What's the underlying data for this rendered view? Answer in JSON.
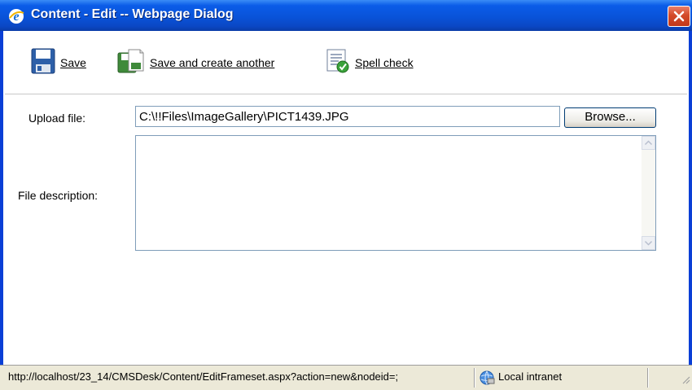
{
  "window": {
    "title": "Content - Edit -- Webpage Dialog"
  },
  "toolbar": {
    "save_label": "Save",
    "save_another_label": "Save and create another",
    "spell_check_label": "Spell check"
  },
  "form": {
    "upload_label": "Upload file:",
    "upload_value": "C:\\!!Files\\ImageGallery\\PICT1439.JPG",
    "browse_label": "Browse...",
    "description_label": "File description:",
    "description_value": ""
  },
  "statusbar": {
    "url": "http://localhost/23_14/CMSDesk/Content/EditFrameset.aspx?action=new&nodeid=;",
    "zone": "Local intranet"
  },
  "colors": {
    "titlebar": "#0953d9",
    "frame_border": "#0a3fd6",
    "close_button": "#d44a28",
    "statusbar": "#ece9d8"
  },
  "icons": {
    "title": "ie-icon",
    "close": "close-icon",
    "save": "floppy-disk-icon",
    "save_another": "save-new-document-icon",
    "spell": "spell-check-icon",
    "zone": "local-intranet-icon"
  }
}
